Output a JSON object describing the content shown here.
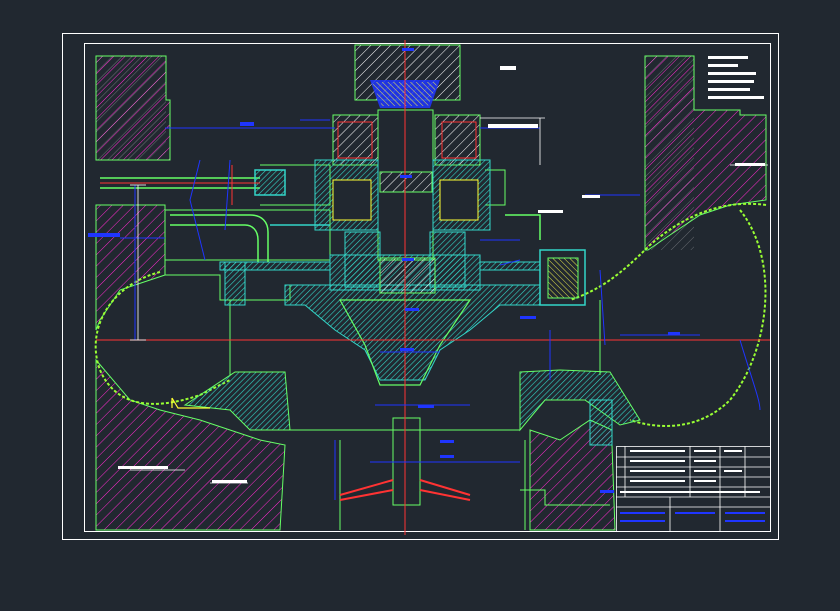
{
  "viewer": {
    "background": "#212830"
  },
  "drawing": {
    "palette": {
      "frame": "#ffffff",
      "hatch": "#ff2bd0",
      "outline": "#66ff66",
      "dimension": "#1f35ff",
      "centerline": "#ff3333",
      "fill_cyan": "#33d6c8",
      "yellow": "#ffff33",
      "bright": "#ffffff"
    },
    "notes": [],
    "title_block": {
      "rows": 9,
      "cols": 6
    }
  }
}
